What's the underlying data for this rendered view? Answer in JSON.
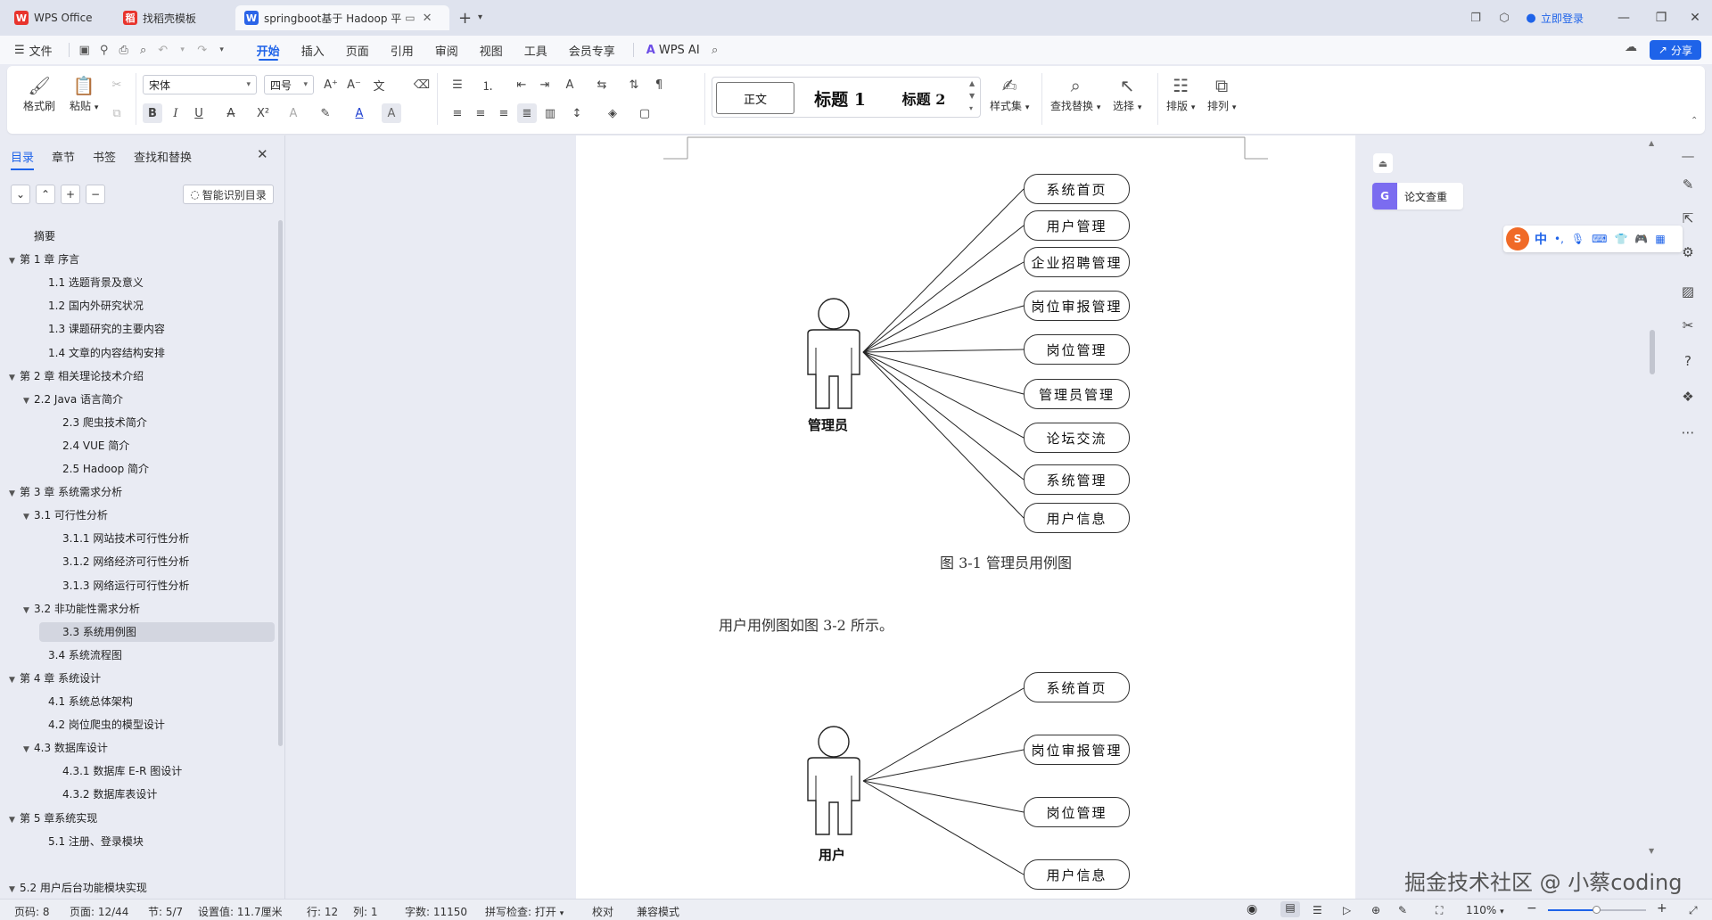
{
  "titlebar": {
    "tabs": [
      {
        "label": "WPS Office",
        "icon": "wps-logo"
      },
      {
        "label": "找稻壳模板",
        "icon": "docer-icon"
      },
      {
        "label": "springboot基于 Hadoop 平",
        "icon": "word-doc-icon"
      }
    ],
    "login": "立即登录"
  },
  "menubar": {
    "file": "文件",
    "items": [
      "开始",
      "插入",
      "页面",
      "引用",
      "审阅",
      "视图",
      "工具",
      "会员专享"
    ],
    "active": "开始",
    "wps_ai": "WPS AI",
    "share": "分享"
  },
  "ribbon": {
    "format_painter": "格式刷",
    "paste": "粘贴",
    "font_name": "宋体",
    "font_size": "四号",
    "styles": [
      "正文",
      "标题 1",
      "标题 2"
    ],
    "style_set": "样式集",
    "find_replace": "查找替换",
    "select": "选择",
    "layout": "排版",
    "arrange": "排列"
  },
  "nav": {
    "tabs": [
      "目录",
      "章节",
      "书签",
      "查找和替换"
    ],
    "smart_toc": "智能识别目录",
    "toc": [
      {
        "label": "摘要",
        "level": 1,
        "arrow": false
      },
      {
        "label": "第 1 章  序言",
        "level": 0,
        "arrow": true
      },
      {
        "label": "1.1 选题背景及意义",
        "level": 2,
        "arrow": false
      },
      {
        "label": "1.2 国内外研究状况",
        "level": 2,
        "arrow": false
      },
      {
        "label": "1.3 课题研究的主要内容",
        "level": 2,
        "arrow": false
      },
      {
        "label": "1.4 文章的内容结构安排",
        "level": 2,
        "arrow": false
      },
      {
        "label": "第 2 章  相关理论技术介绍",
        "level": 0,
        "arrow": true
      },
      {
        "label": "2.2 Java 语言简介",
        "level": 1,
        "arrow": true
      },
      {
        "label": "2.3   爬虫技术简介",
        "level": 3,
        "arrow": false
      },
      {
        "label": "2.4 VUE 简介",
        "level": 3,
        "arrow": false
      },
      {
        "label": "2.5     Hadoop 简介",
        "level": 3,
        "arrow": false
      },
      {
        "label": "第 3 章    系统需求分析",
        "level": 0,
        "arrow": true
      },
      {
        "label": "3.1  可行性分析",
        "level": 1,
        "arrow": true
      },
      {
        "label": "3.1.1  网站技术可行性分析",
        "level": 3,
        "arrow": false
      },
      {
        "label": "3.1.2 网络经济可行性分析",
        "level": 3,
        "arrow": false
      },
      {
        "label": "3.1.3 网络运行可行性分析",
        "level": 3,
        "arrow": false
      },
      {
        "label": "3.2  非功能性需求分析",
        "level": 1,
        "arrow": true
      },
      {
        "label": "3.3 系统用例图",
        "level": 3,
        "arrow": false,
        "selected": true
      },
      {
        "label": "3.4  系统流程图",
        "level": 2,
        "arrow": false
      },
      {
        "label": "第 4 章    系统设计",
        "level": 0,
        "arrow": true
      },
      {
        "label": "4.1 系统总体架构",
        "level": 2,
        "arrow": false
      },
      {
        "label": "4.2 岗位爬虫的模型设计",
        "level": 2,
        "arrow": false
      },
      {
        "label": "4.3    数据库设计",
        "level": 1,
        "arrow": true
      },
      {
        "label": "4.3.1    数据库 E-R 图设计",
        "level": 3,
        "arrow": false
      },
      {
        "label": "4.3.2    数据库表设计",
        "level": 3,
        "arrow": false
      },
      {
        "label": "第 5 章系统实现",
        "level": 0,
        "arrow": true
      },
      {
        "label": "5.1 注册、登录模块",
        "level": 2,
        "arrow": false
      },
      {
        "label": "",
        "level": 2,
        "arrow": false
      },
      {
        "label": "5.2  用户后台功能模块实现",
        "level": 0,
        "arrow": true
      }
    ]
  },
  "document": {
    "diagram1": {
      "actor": "管理员",
      "usecases": [
        "系统首页",
        "用户管理",
        "企业招聘管理",
        "岗位审报管理",
        "岗位管理",
        "管理员管理",
        "论坛交流",
        "系统管理",
        "用户信息"
      ],
      "caption": "图 3-1 管理员用例图"
    },
    "body_text": "用户用例图如图 3-2 所示。",
    "diagram2": {
      "actor": "用户",
      "usecases": [
        "系统首页",
        "岗位审报管理",
        "岗位管理",
        "用户信息"
      ]
    }
  },
  "right_panel": {
    "lunwen": "论文查重",
    "ime": "中"
  },
  "watermark": "掘金技术社区 @ 小蔡coding",
  "statusbar": {
    "page_num": "页码: 8",
    "page": "页面: 12/44",
    "section": "节: 5/7",
    "setting": "设置值: 11.7厘米",
    "row": "行: 12",
    "col": "列: 1",
    "words": "字数: 11150",
    "spell": "拼写检查: 打开",
    "proof": "校对",
    "compat": "兼容模式",
    "zoom": "110%"
  },
  "colors": {
    "accent": "#1e63e9",
    "wps_red": "#e8342d",
    "page": "#ffffff",
    "bg": "#e9ebf3"
  }
}
